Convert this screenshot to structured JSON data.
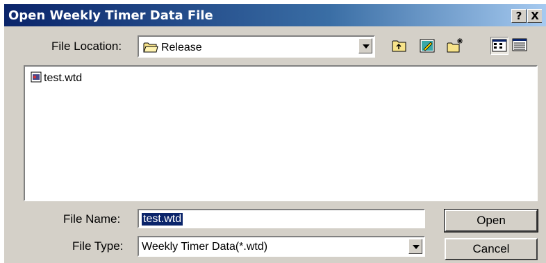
{
  "window": {
    "title": "Open Weekly Timer Data File",
    "help_button": "?",
    "close_button": "X"
  },
  "location": {
    "label": "File Location:",
    "value": "Release"
  },
  "toolbar": {
    "up_icon": "folder-up-icon",
    "desktop_icon": "desktop-icon",
    "new_folder_icon": "new-folder-icon",
    "list_view_icon": "list-view-icon",
    "details_view_icon": "details-view-icon"
  },
  "files": [
    {
      "name": "test.wtd",
      "icon": "wtd-file-icon"
    }
  ],
  "filename": {
    "label": "File Name:",
    "value": "test.wtd"
  },
  "filetype": {
    "label": "File Type:",
    "value": "Weekly Timer Data(*.wtd)"
  },
  "buttons": {
    "open": "Open",
    "cancel": "Cancel"
  },
  "colors": {
    "titlebar_start": "#0a246a",
    "titlebar_end": "#a6caf0",
    "dialog_face": "#d4d0c8",
    "selection": "#0a246a"
  }
}
